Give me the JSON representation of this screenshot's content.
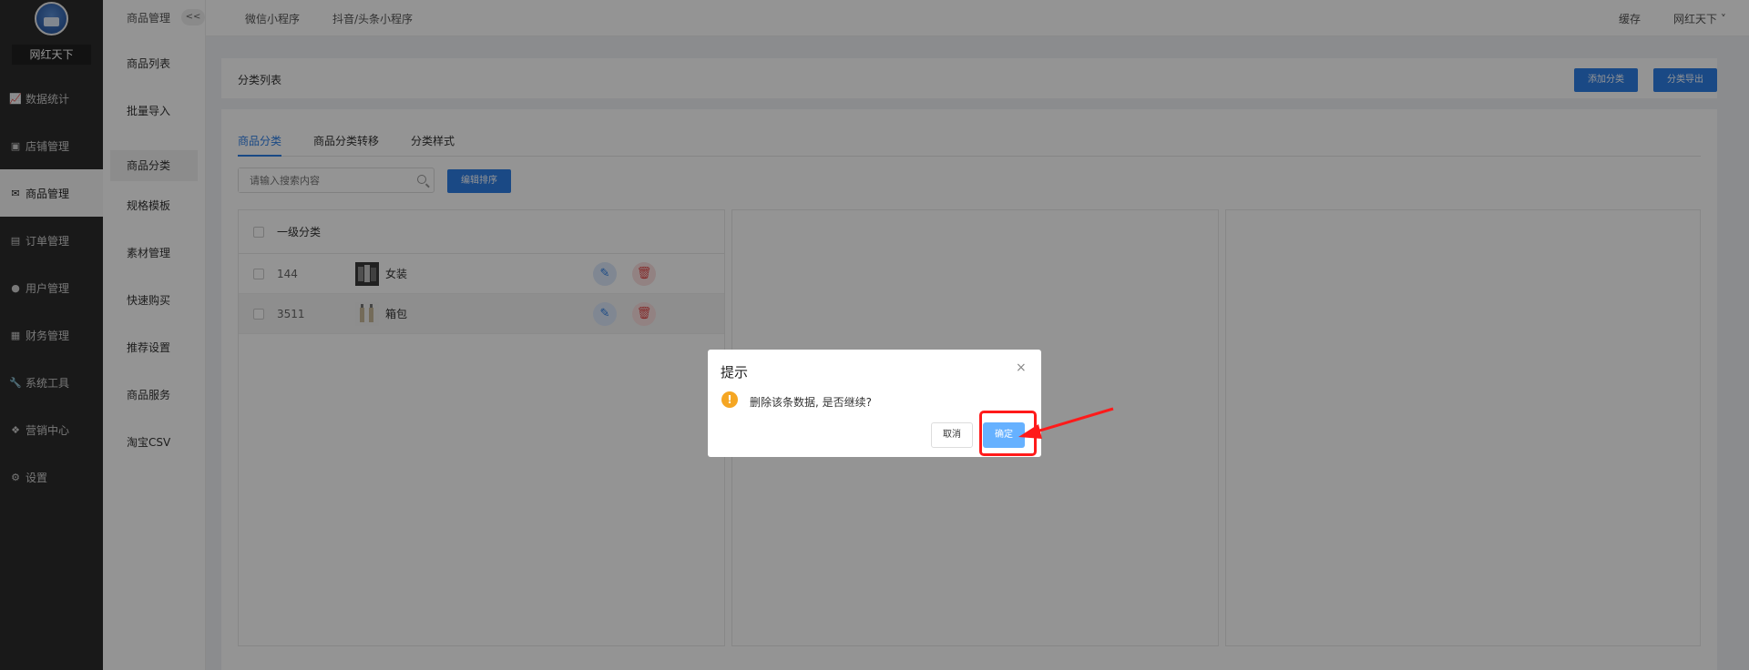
{
  "sidebar": {
    "brand": "网红天下",
    "items": [
      {
        "label": "数据统计",
        "icon": "chart-icon"
      },
      {
        "label": "店铺管理",
        "icon": "shop-icon"
      },
      {
        "label": "商品管理",
        "icon": "goods-icon"
      },
      {
        "label": "订单管理",
        "icon": "order-icon"
      },
      {
        "label": "用户管理",
        "icon": "user-icon"
      },
      {
        "label": "财务管理",
        "icon": "finance-icon"
      },
      {
        "label": "系统工具",
        "icon": "wrench-icon"
      },
      {
        "label": "营销中心",
        "icon": "marketing-icon"
      },
      {
        "label": "设置",
        "icon": "gear-icon"
      }
    ]
  },
  "subbar": {
    "title": "商品管理",
    "collapse": "<<",
    "items": [
      "商品列表",
      "批量导入",
      "商品分类",
      "规格模板",
      "素材管理",
      "快速购买",
      "推荐设置",
      "商品服务",
      "淘宝CSV"
    ]
  },
  "topbar": {
    "tabs": [
      "微信小程序",
      "抖音/头条小程序"
    ],
    "cache": "缓存",
    "user": "网红天下",
    "user_arrow": "˅"
  },
  "panel": {
    "title": "分类列表",
    "add_button": "添加分类",
    "export_button": "分类导出"
  },
  "tabs": [
    "商品分类",
    "商品分类转移",
    "分类样式"
  ],
  "search": {
    "placeholder": "请输入搜索内容"
  },
  "edit_sort_button": "编辑排序",
  "table": {
    "header": "一级分类",
    "rows": [
      {
        "id": "144",
        "name": "女装"
      },
      {
        "id": "3511",
        "name": "箱包"
      }
    ]
  },
  "dialog": {
    "title": "提示",
    "close": "×",
    "warn_glyph": "!",
    "message": "删除该条数据, 是否继续?",
    "cancel": "取消",
    "ok": "确定"
  },
  "colors": {
    "primary": "#2d7ee6",
    "highlight": "#ff1a1a",
    "warning": "#f5a623"
  }
}
